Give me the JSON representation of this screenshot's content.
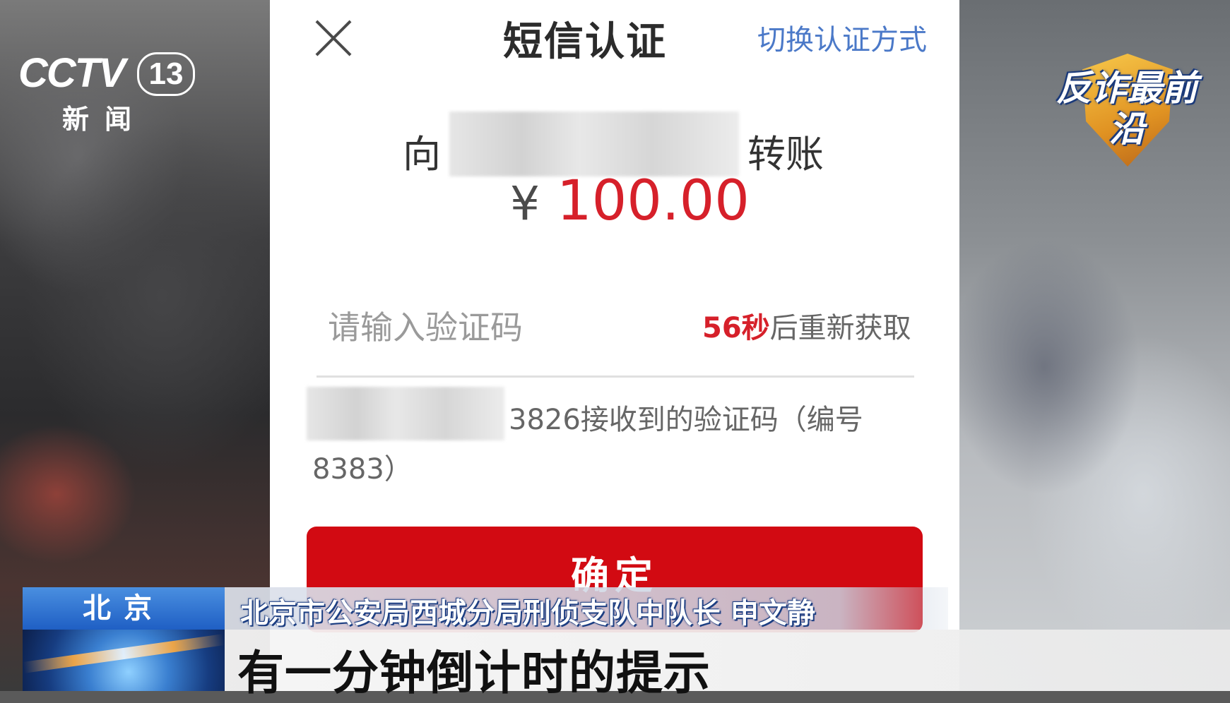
{
  "broadcast": {
    "channel_word": "CCTV",
    "channel_number": "13",
    "channel_sub": "新闻",
    "program_badge": "反诈最前沿"
  },
  "phone_screen": {
    "header": {
      "title": "短信认证",
      "switch_link": "切换认证方式"
    },
    "transfer": {
      "prefix": "向",
      "suffix": "转账",
      "currency_symbol": "¥",
      "amount": "100.00"
    },
    "verification": {
      "placeholder": "请输入验证码",
      "countdown_seconds": "56秒",
      "countdown_text": "后重新获取",
      "sms_notice_line1": "3826接收到的验证码（编号",
      "sms_notice_line2": "8383）"
    },
    "confirm_label": "确定"
  },
  "lower_third": {
    "location": "北京",
    "speaker": "北京市公安局西城分局刑侦支队中队长  申文静",
    "subtitle": "有一分钟倒计时的提示"
  },
  "colors": {
    "accent_red": "#d20a12",
    "link_blue": "#4b79c8",
    "location_blue": "#1f5fc4"
  }
}
